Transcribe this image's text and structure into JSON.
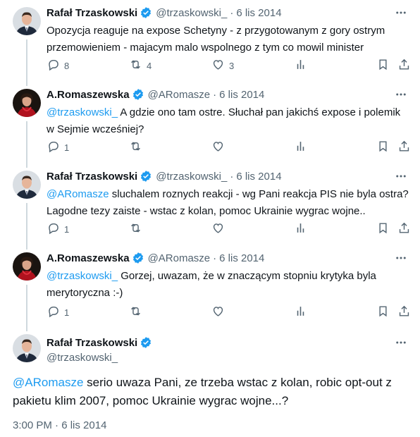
{
  "tweets": [
    {
      "name": "Rafał Trzaskowski",
      "handle": "@trzaskowski_",
      "dot": "·",
      "date": "6 lis 2014",
      "text": "Opozycja reaguje na expose Schetyny - z przygotowanym z gory ostrym przemowieniem - majacym malo wspolnego z tym co mowil minister",
      "replies": "8",
      "retweets": "4",
      "likes": "3"
    },
    {
      "name": "A.Romaszewska",
      "handle": "@ARomasze",
      "dot": "·",
      "date": "6 lis 2014",
      "mention": "@trzaskowski_",
      "text": " A gdzie ono tam ostre. Słuchał pan jakichś expose i polemik w Sejmie wcześniej?",
      "replies": "1",
      "retweets": "",
      "likes": ""
    },
    {
      "name": "Rafał Trzaskowski",
      "handle": "@trzaskowski_",
      "dot": "·",
      "date": "6 lis 2014",
      "mention": "@ARomasze",
      "text": " sluchalem roznych reakcji - wg Pani reakcja PIS nie byla ostra? Lagodne tezy zaiste - wstac z kolan, pomoc Ukrainie wygrac wojne..",
      "replies": "1",
      "retweets": "",
      "likes": ""
    },
    {
      "name": "A.Romaszewska",
      "handle": "@ARomasze",
      "dot": "·",
      "date": "6 lis 2014",
      "mention": "@trzaskowski_",
      "text": " Gorzej, uwazam, że w znaczącym stopniu krytyka byla merytoryczna :-)",
      "replies": "1",
      "retweets": "",
      "likes": ""
    }
  ],
  "main": {
    "name": "Rafał Trzaskowski",
    "handle": "@trzaskowski_",
    "mention": "@ARomasze",
    "text": " serio uwaza Pani, ze trzeba wstac z kolan, robic opt-out z pakietu klim 2007, pomoc Ukrainie wygrac wojne...?",
    "time": "3:00 PM",
    "dot": "·",
    "date": "6 lis 2014"
  },
  "colors": {
    "accent": "#1d9bf0",
    "secondary_text": "#536471",
    "thread_line": "#cfd9de"
  },
  "icons": {
    "reply": "reply-icon",
    "retweet": "retweet-icon",
    "like": "heart-icon",
    "views": "views-icon",
    "bookmark": "bookmark-icon",
    "share": "share-icon",
    "more": "more-icon",
    "verified": "verified-badge-icon"
  }
}
